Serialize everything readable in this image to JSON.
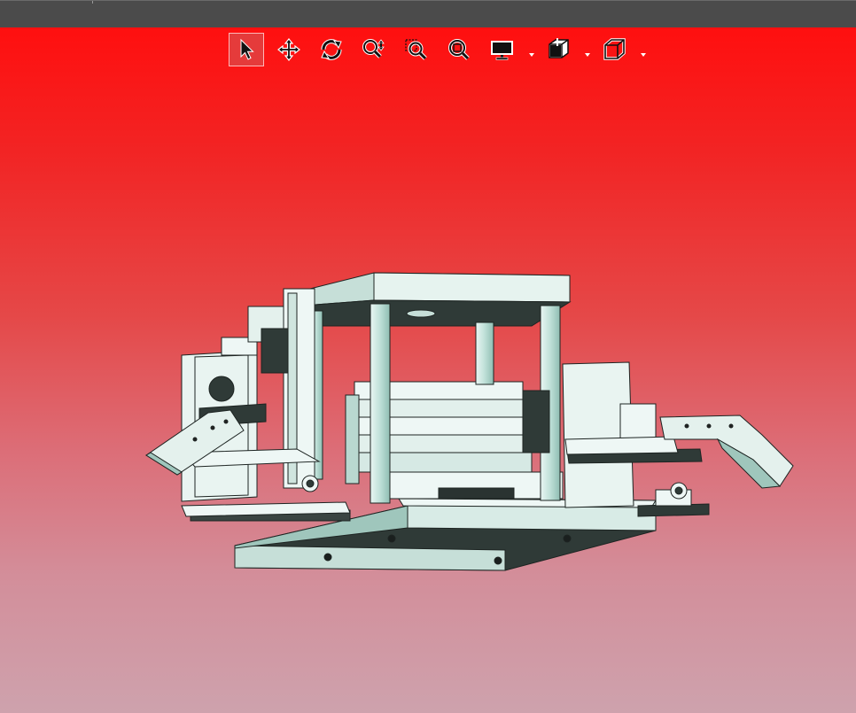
{
  "app": {
    "viewport_background_top": "#ff0f0f",
    "viewport_background_bottom": "#cea2ad",
    "titlebar_color": "#4b4b4b"
  },
  "toolbar": {
    "tools": [
      {
        "name": "select",
        "icon": "arrow-cursor-icon",
        "active": true
      },
      {
        "name": "pan",
        "icon": "move-arrows-icon",
        "active": false
      },
      {
        "name": "rotate",
        "icon": "rotate-icon",
        "active": false
      },
      {
        "name": "zoom",
        "icon": "zoom-updown-icon",
        "active": false
      },
      {
        "name": "zoom-window",
        "icon": "zoom-window-icon",
        "active": false
      },
      {
        "name": "zoom-fit",
        "icon": "zoom-fit-icon",
        "active": false
      },
      {
        "name": "display-mode",
        "icon": "monitor-icon",
        "active": false,
        "has_dropdown": true
      },
      {
        "name": "section-view",
        "icon": "section-box-icon",
        "active": false,
        "has_dropdown": true
      },
      {
        "name": "view-orientation",
        "icon": "cube-icon",
        "active": false,
        "has_dropdown": true
      }
    ]
  },
  "model": {
    "description_icon": "cad-machine-assembly-model",
    "face_color": "#c9e2db",
    "dark_color": "#2f3a37"
  }
}
